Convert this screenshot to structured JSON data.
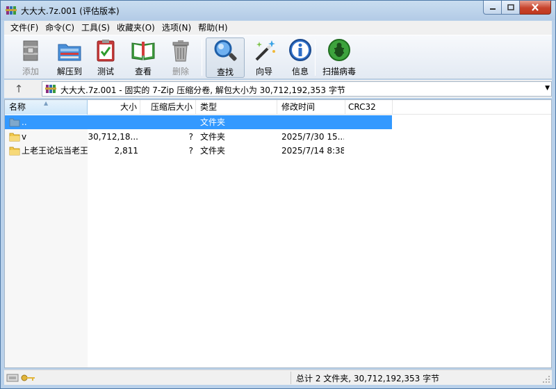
{
  "window": {
    "title": "大大大.7z.001 (评估版本)"
  },
  "menu": [
    {
      "label": "文件(F)"
    },
    {
      "label": "命令(C)"
    },
    {
      "label": "工具(S)"
    },
    {
      "label": "收藏夹(O)"
    },
    {
      "label": "选项(N)"
    },
    {
      "label": "帮助(H)"
    }
  ],
  "toolbar": [
    {
      "label": "添加",
      "icon": "add-archive-icon",
      "disabled": true
    },
    {
      "label": "解压到",
      "icon": "extract-to-icon",
      "disabled": false
    },
    {
      "label": "测试",
      "icon": "test-clipboard-icon",
      "disabled": false
    },
    {
      "label": "查看",
      "icon": "view-book-icon",
      "disabled": false
    },
    {
      "label": "删除",
      "icon": "delete-trash-icon",
      "disabled": true
    },
    {
      "label": "查找",
      "icon": "find-magnifier-icon",
      "disabled": false
    },
    {
      "label": "向导",
      "icon": "wizard-wand-icon",
      "disabled": false
    },
    {
      "label": "信息",
      "icon": "info-icon",
      "disabled": false
    },
    {
      "label": "扫描病毒",
      "icon": "virus-scan-bug-icon",
      "disabled": false
    }
  ],
  "address": {
    "text": "大大大.7z.001 - 固实的 7-Zip 压缩分卷, 解包大小为 30,712,192,353 字节"
  },
  "columns": [
    {
      "label": "名称"
    },
    {
      "label": "大小"
    },
    {
      "label": "压缩后大小"
    },
    {
      "label": "类型"
    },
    {
      "label": "修改时间"
    },
    {
      "label": "CRC32"
    }
  ],
  "rows": [
    {
      "name": "..",
      "size": "",
      "packed": "",
      "type": "文件夹",
      "modified": "",
      "crc": "",
      "selected": true,
      "icon": "parent-folder-icon"
    },
    {
      "name": "v",
      "size": "30,712,18...",
      "packed": "?",
      "type": "文件夹",
      "modified": "2025/7/30 15...",
      "crc": "",
      "selected": false,
      "icon": "folder-icon"
    },
    {
      "name": "上老王论坛当老王",
      "size": "2,811",
      "packed": "?",
      "type": "文件夹",
      "modified": "2025/7/14 8:38",
      "crc": "",
      "selected": false,
      "icon": "folder-icon"
    }
  ],
  "status": {
    "text": "总计 2 文件夹, 30,712,192,353 字节"
  },
  "colors": {
    "selection": "#3399ff",
    "title_bg": "#b9d1ea"
  }
}
